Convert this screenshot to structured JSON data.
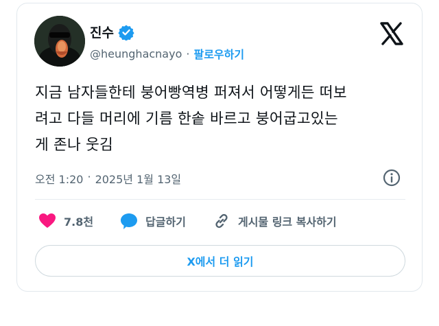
{
  "user": {
    "display_name": "진수",
    "handle": "@heunghacnayo",
    "follow_label": "팔로우하기",
    "separator": "·"
  },
  "tweet": {
    "lines": [
      "지금 남자들한테 붕어빵역병 퍼져서 어떻게든 떠보",
      "려고 다들 머리에 기름 한솥 바르고 붕어굽고있는",
      "게 존나 웃김"
    ],
    "time": "오전 1:20",
    "separator": "·",
    "date": "2025년 1월 13일"
  },
  "actions": {
    "likes": "7.8천",
    "reply": "답글하기",
    "copy_link": "게시물 링크 복사하기"
  },
  "read_more": "X에서 더 읽기",
  "colors": {
    "accent": "#1d9bf0",
    "like": "#f91880",
    "muted": "#536471",
    "verified": "#1d9bf0"
  },
  "icons": [
    "verified-badge-icon",
    "x-logo-icon",
    "info-icon",
    "heart-icon",
    "reply-bubble-icon",
    "link-icon"
  ]
}
